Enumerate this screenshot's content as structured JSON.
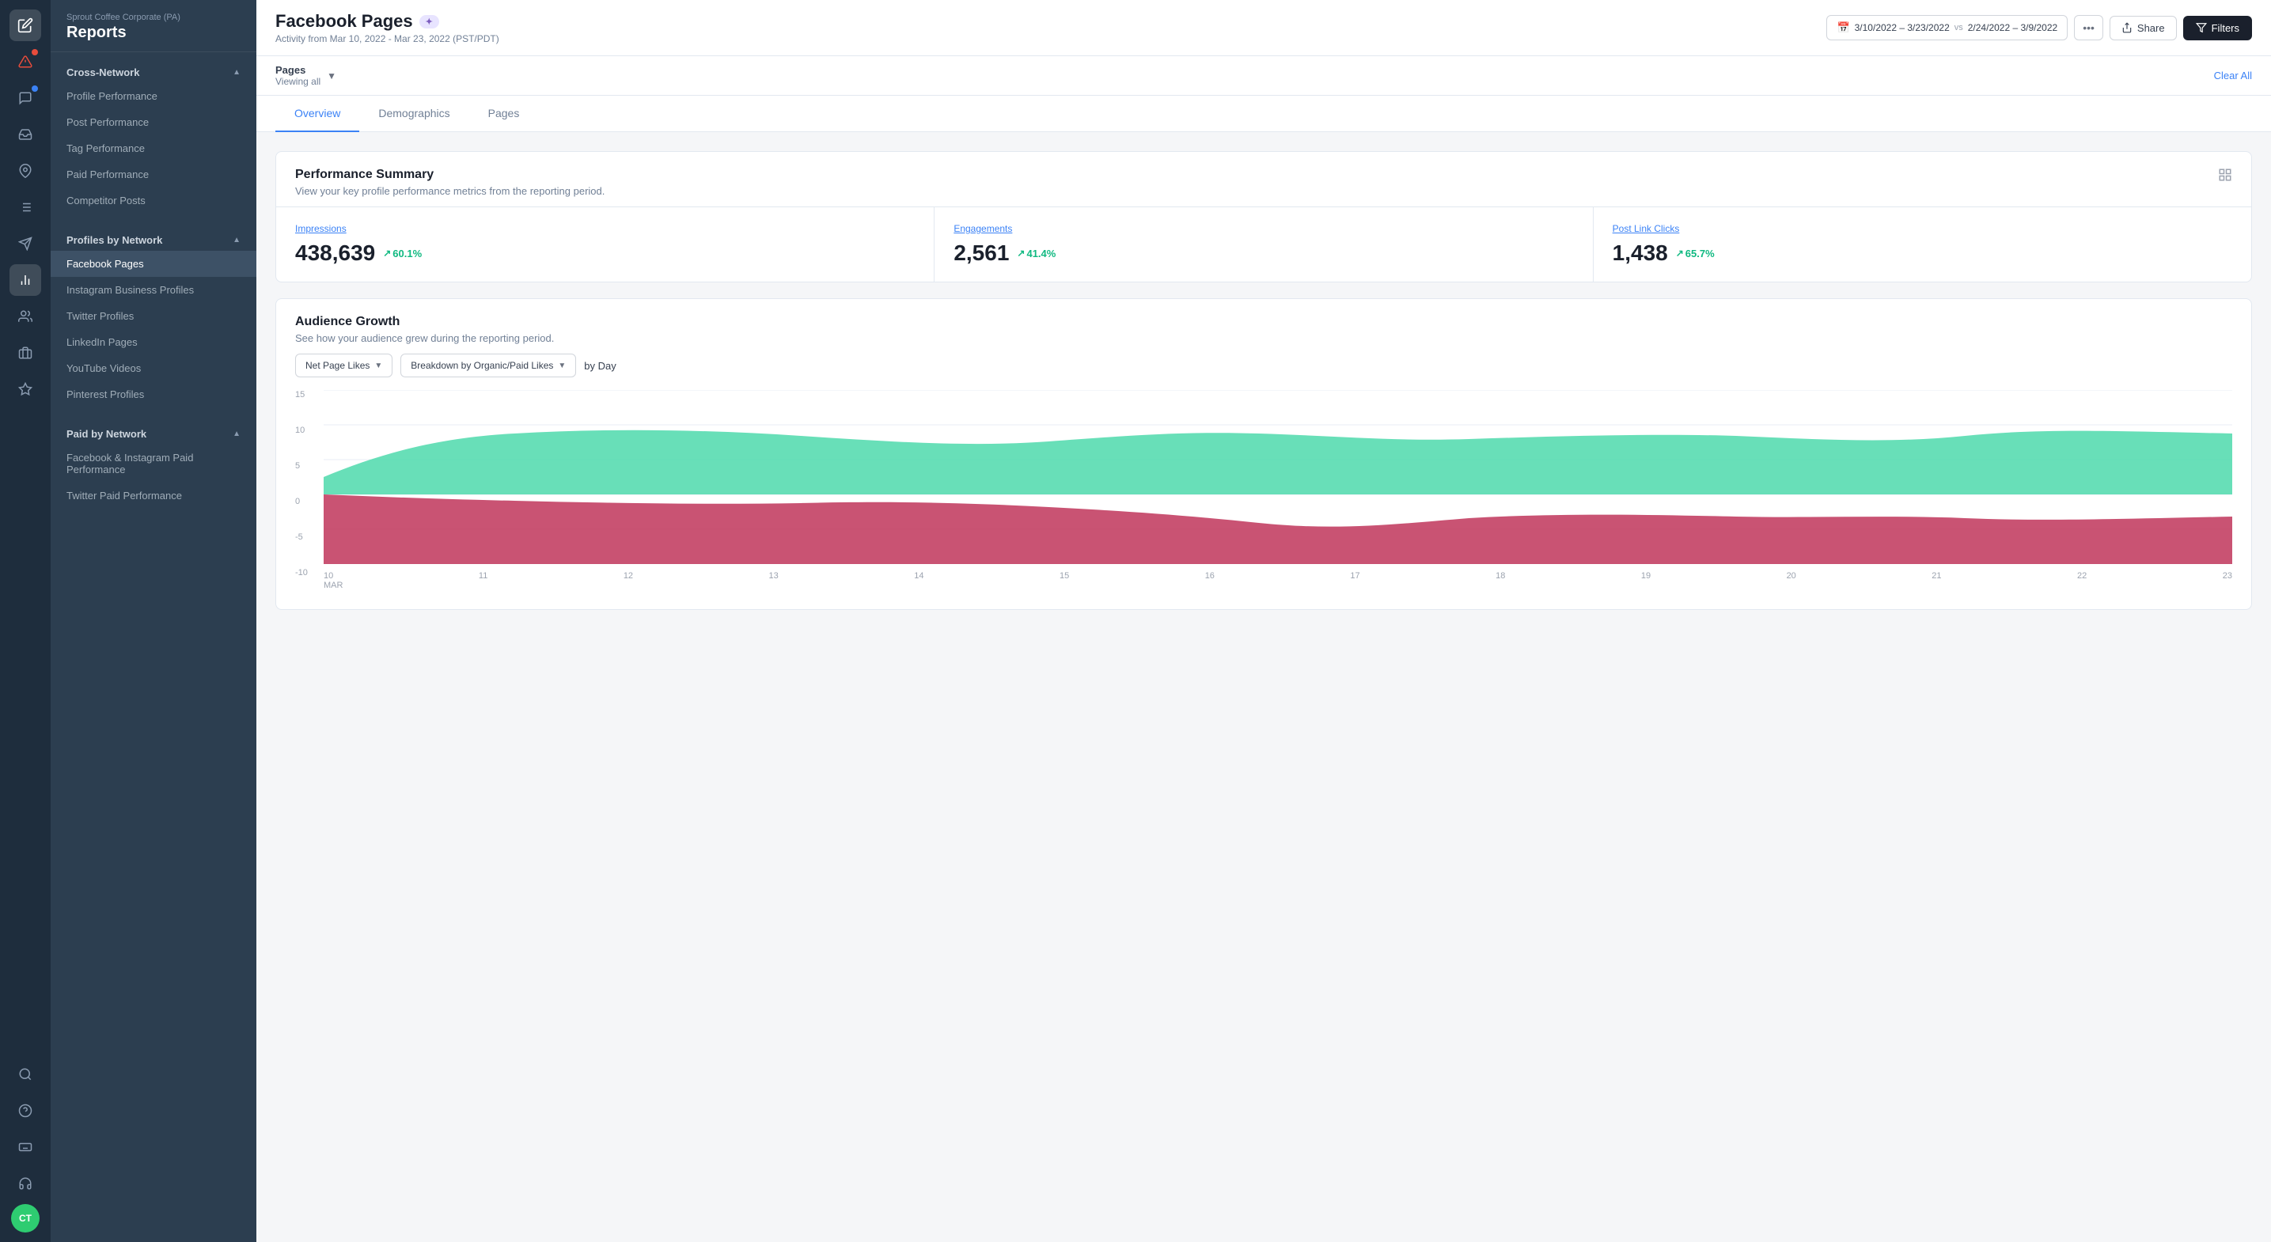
{
  "org": "Sprout Coffee Corporate (PA)",
  "reports_label": "Reports",
  "page": {
    "title": "Facebook Pages",
    "badge": "✦",
    "subtitle": "Activity from Mar 10, 2022 - Mar 23, 2022 (PST/PDT)"
  },
  "topbar": {
    "date_range": "3/10/2022 – 3/23/2022",
    "vs_label": "vs",
    "compare_range": "2/24/2022 – 3/9/2022",
    "more_label": "•••",
    "share_label": "Share",
    "filters_label": "Filters"
  },
  "filter_bar": {
    "pages_label": "Pages",
    "viewing_label": "Viewing all",
    "clear_label": "Clear All"
  },
  "tabs": [
    {
      "id": "overview",
      "label": "Overview",
      "active": true
    },
    {
      "id": "demographics",
      "label": "Demographics",
      "active": false
    },
    {
      "id": "pages",
      "label": "Pages",
      "active": false
    }
  ],
  "performance_summary": {
    "title": "Performance Summary",
    "subtitle": "View your key profile performance metrics from the reporting period.",
    "metrics": [
      {
        "label": "Impressions",
        "value": "438,639",
        "change": "60.1%"
      },
      {
        "label": "Engagements",
        "value": "2,561",
        "change": "41.4%"
      },
      {
        "label": "Post Link Clicks",
        "value": "1,438",
        "change": "65.7%"
      }
    ]
  },
  "audience_growth": {
    "title": "Audience Growth",
    "subtitle": "See how your audience grew during the reporting period.",
    "metric_select": "Net Page Likes",
    "breakdown_select": "Breakdown by Organic/Paid Likes",
    "interval_label": "by Day"
  },
  "chart": {
    "y_labels": [
      "15",
      "10",
      "5",
      "0",
      "-5",
      "-10"
    ],
    "x_labels": [
      "10\nMAR",
      "11",
      "12",
      "13",
      "14",
      "15",
      "16",
      "17",
      "18",
      "19",
      "20",
      "21",
      "22",
      "23"
    ]
  },
  "sidebar": {
    "cross_network": {
      "label": "Cross-Network",
      "items": [
        {
          "id": "profile-performance",
          "label": "Profile Performance"
        },
        {
          "id": "post-performance",
          "label": "Post Performance"
        },
        {
          "id": "tag-performance",
          "label": "Tag Performance"
        },
        {
          "id": "paid-performance",
          "label": "Paid Performance"
        },
        {
          "id": "competitor-posts",
          "label": "Competitor Posts"
        }
      ]
    },
    "profiles_by_network": {
      "label": "Profiles by Network",
      "items": [
        {
          "id": "facebook-pages",
          "label": "Facebook Pages",
          "active": true
        },
        {
          "id": "instagram-business",
          "label": "Instagram Business Profiles"
        },
        {
          "id": "twitter-profiles",
          "label": "Twitter Profiles"
        },
        {
          "id": "linkedin-pages",
          "label": "LinkedIn Pages"
        },
        {
          "id": "youtube-videos",
          "label": "YouTube Videos"
        },
        {
          "id": "pinterest-profiles",
          "label": "Pinterest Profiles"
        }
      ]
    },
    "paid_by_network": {
      "label": "Paid by Network",
      "items": [
        {
          "id": "fb-ig-paid",
          "label": "Facebook & Instagram Paid Performance"
        },
        {
          "id": "twitter-paid",
          "label": "Twitter Paid Performance"
        }
      ]
    }
  },
  "rail_icons": [
    {
      "id": "compose",
      "symbol": "✏",
      "active": true,
      "badge": false
    },
    {
      "id": "alert",
      "symbol": "⚠",
      "active": false,
      "badge": true
    },
    {
      "id": "messages",
      "symbol": "💬",
      "active": false,
      "badge": true,
      "badge_color": "blue"
    },
    {
      "id": "inbox",
      "symbol": "📥",
      "active": false
    },
    {
      "id": "pins",
      "symbol": "📌",
      "active": false
    },
    {
      "id": "tasks",
      "symbol": "☰",
      "active": false
    },
    {
      "id": "send",
      "symbol": "✈",
      "active": false
    },
    {
      "id": "reports",
      "symbol": "📊",
      "active": true
    },
    {
      "id": "groups",
      "symbol": "👥",
      "active": false
    },
    {
      "id": "briefcase",
      "symbol": "💼",
      "active": false
    },
    {
      "id": "star",
      "symbol": "★",
      "active": false
    },
    {
      "id": "search",
      "symbol": "🔍",
      "active": false
    },
    {
      "id": "help",
      "symbol": "?",
      "active": false
    },
    {
      "id": "keyboard",
      "symbol": "⌨",
      "active": false
    },
    {
      "id": "support",
      "symbol": "🎧",
      "active": false
    }
  ],
  "avatar": "CT"
}
